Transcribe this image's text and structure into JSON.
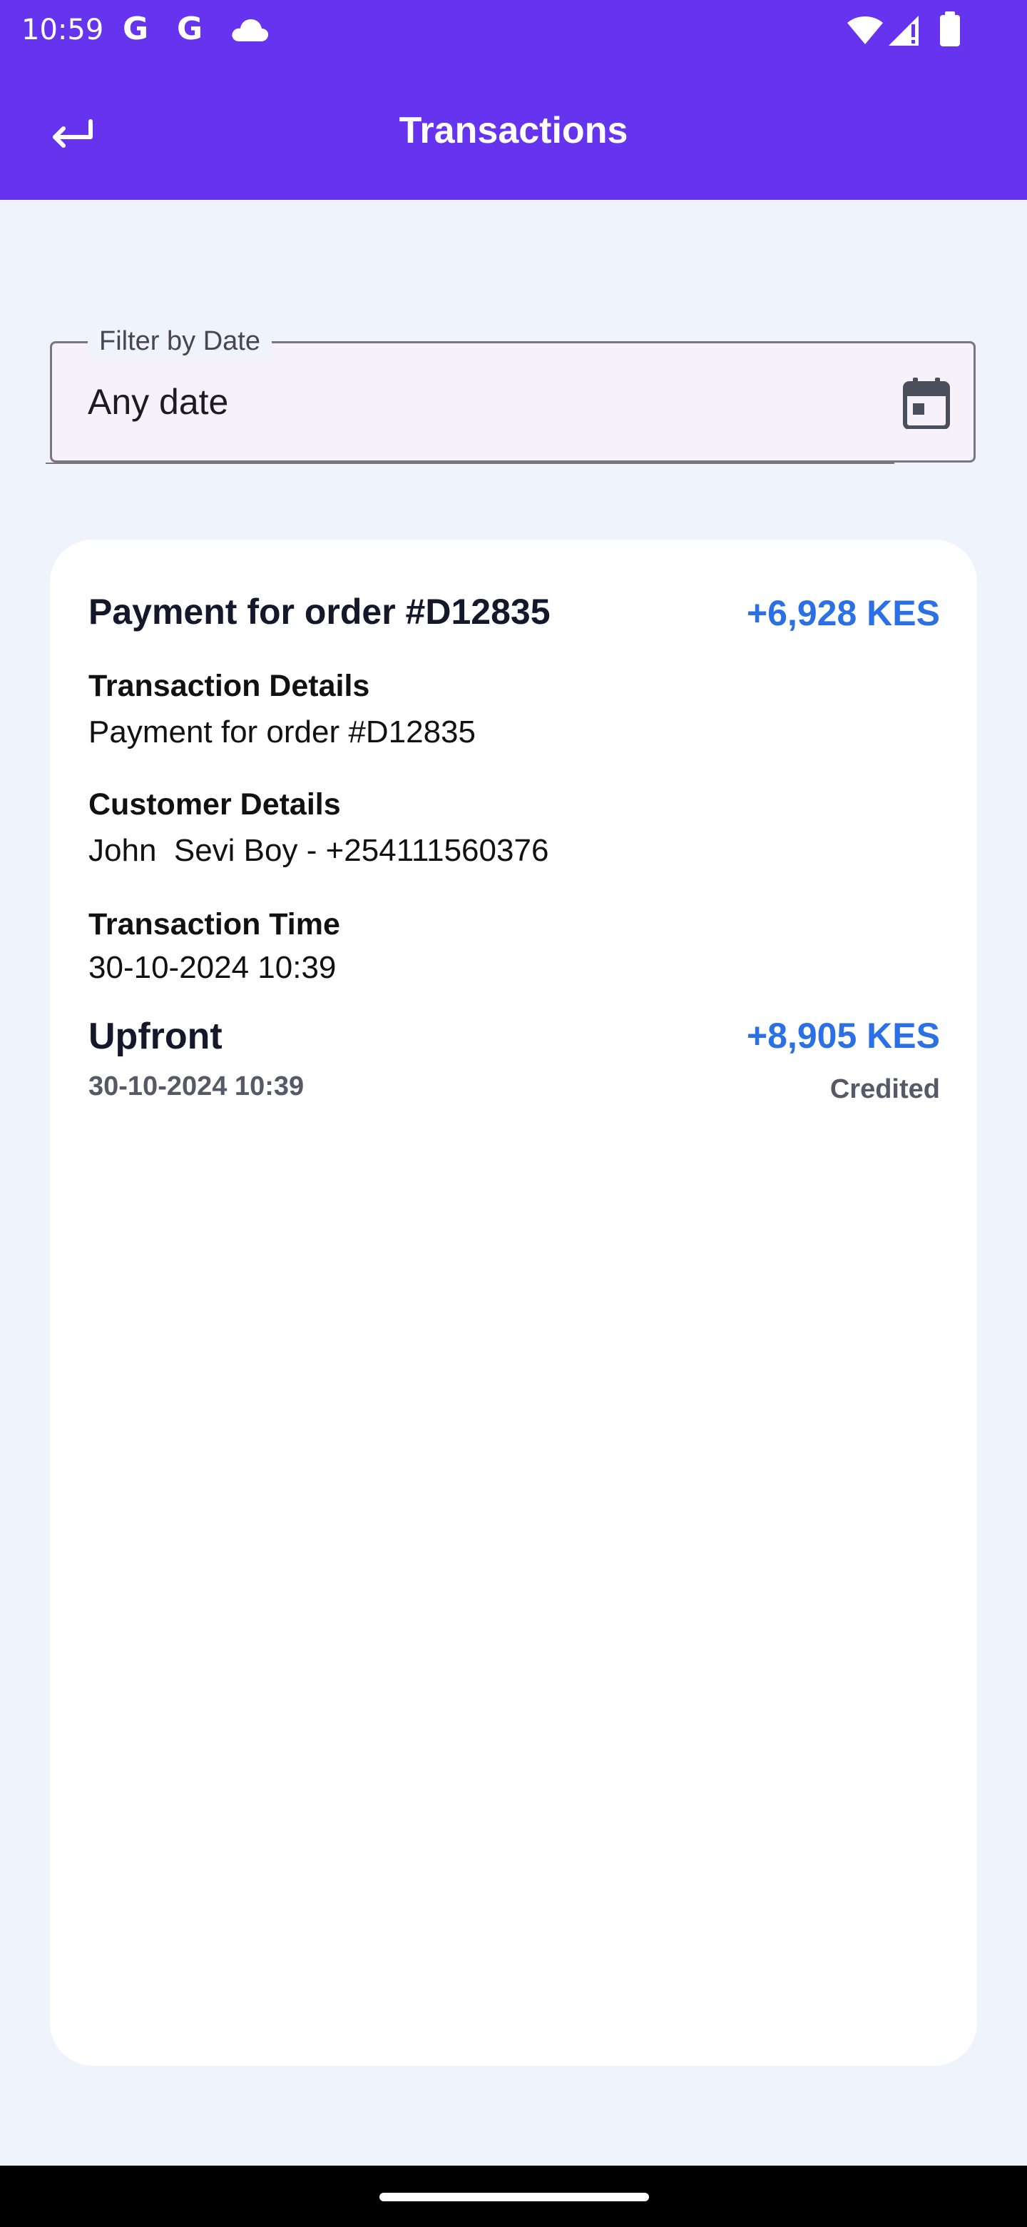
{
  "status_bar": {
    "time": "10:59",
    "notification_letters": [
      "G",
      "G"
    ],
    "icons": [
      "google-icon",
      "google-icon",
      "cloud-icon",
      "wifi-icon",
      "signal-icon",
      "battery-icon"
    ]
  },
  "app_bar": {
    "title": "Transactions",
    "back_icon": "back-arrow-icon"
  },
  "filter": {
    "label": "Filter by Date",
    "value": "Any date",
    "icon": "calendar-icon"
  },
  "transaction": {
    "title": "Payment for order #D12835",
    "amount": "+6,928 KES",
    "details_label": "Transaction Details",
    "details_value": "Payment for order #D12835",
    "customer_label": "Customer Details",
    "customer_value": "John  Sevi Boy - +254111560376",
    "time_label": "Transaction Time",
    "time_value": "30-10-2024 10:39",
    "entry": {
      "label": "Upfront",
      "date": "30-10-2024 10:39",
      "amount": "+8,905 KES",
      "status": "Credited"
    }
  },
  "colors": {
    "primary": "#6633ee",
    "amount_blue": "#2b70e4",
    "background": "#eff3fb",
    "card": "#ffffff"
  }
}
